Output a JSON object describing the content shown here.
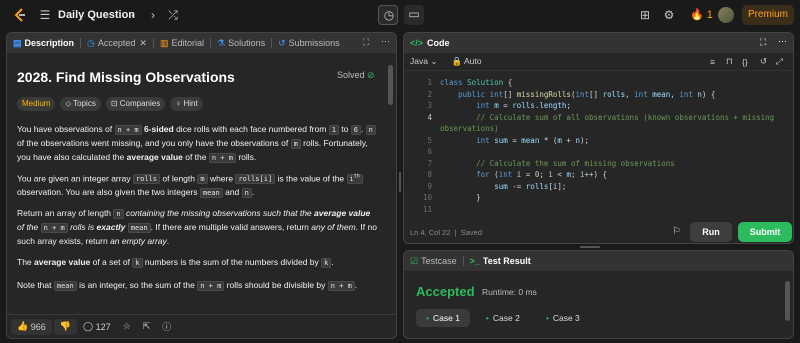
{
  "topbar": {
    "title": "Daily Question",
    "streak": "1",
    "premium": "Premium"
  },
  "left": {
    "tabs": [
      "Description",
      "Accepted",
      "Editorial",
      "Solutions",
      "Submissions"
    ],
    "title": "2028. Find Missing Observations",
    "solved": "Solved",
    "chips": [
      "Medium",
      "Topics",
      "Companies",
      "Hint"
    ],
    "p1": {
      "a": "You have observations of ",
      "c1": "n + m",
      "b": " 6-sided",
      "c": " dice rolls with each face numbered from ",
      "c2": "1",
      "d": " to ",
      "c3": "6",
      "e": ". ",
      "c4": "n",
      "f": " of the observations went missing, and you only have the observations of ",
      "c5": "m",
      "g": " rolls. Fortunately, you have also calculated the ",
      "h": "average value",
      "i": " of the ",
      "c6": "n + m",
      "j": " rolls."
    },
    "p2": {
      "a": "You are given an integer array ",
      "c1": "rolls",
      "b": " of length ",
      "c2": "m",
      "c": " where ",
      "c3": "rolls[i]",
      "d": " is the value of the ",
      "c4": "i",
      "sup": "th",
      "e": " observation. You are also given the two integers ",
      "c5": "mean",
      "f": " and ",
      "c6": "n",
      "g": "."
    },
    "p3": {
      "a": "Return an array of length ",
      "c1": "n",
      "b": " containing the missing observations such that the ",
      "bold": "average value",
      "c": " of the ",
      "c2": "n + m",
      "d": " rolls is ",
      "ex": "exactly",
      "c3": "mean",
      "e": ". If there are multiple valid answers, return ",
      "any": "any of them",
      "f": ". If no such array exists, return ",
      "empty": "an empty array",
      "g": "."
    },
    "p4": {
      "a": "The ",
      "bold": "average value",
      "b": " of a set of ",
      "c1": "k",
      "c": " numbers is the sum of the numbers divided by ",
      "c2": "k",
      "d": "."
    },
    "p5": {
      "a": "Note that ",
      "c1": "mean",
      "b": " is an integer, so the sum of the ",
      "c2": "n + m",
      "c": " rolls should be divisible by ",
      "c3": "n + m",
      "d": "."
    },
    "likes": "966",
    "comments": "127"
  },
  "code": {
    "header": "Code",
    "language": "Java",
    "mode": "Auto",
    "lines": [
      {
        "n": "1",
        "html": "<span class='kw'>class</span> <span class='ty'>Solution</span> {"
      },
      {
        "n": "2",
        "html": "    <span class='kw'>public</span> <span class='kw'>int</span>[] <span class='fn'>missingRolls</span>(<span class='kw'>int</span>[] <span class='vr'>rolls</span>, <span class='kw'>int</span> <span class='vr'>mean</span>, <span class='kw'>int</span> <span class='vr'>n</span>) {"
      },
      {
        "n": "3",
        "html": "        <span class='kw'>int</span> <span class='vr'>m</span> = <span class='vr'>rolls</span>.<span class='vr'>length</span>;"
      },
      {
        "n": "4",
        "html": "        <span class='cm'>// Calculate sum of all observations (known observations + missing</span>"
      },
      {
        "n": "",
        "html": "<span class='cm'>observations)</span>"
      },
      {
        "n": "5",
        "html": "        <span class='kw'>int</span> <span class='vr'>sum</span> = <span class='vr'>mean</span> * (<span class='vr'>m</span> + <span class='vr'>n</span>);"
      },
      {
        "n": "6",
        "html": ""
      },
      {
        "n": "7",
        "html": "        <span class='cm'>// Calculate the sum of missing observations</span>"
      },
      {
        "n": "8",
        "html": "        <span class='kw'>for</span> (<span class='kw'>int</span> <span class='vr'>i</span> = <span class='nm'>0</span>; <span class='vr'>i</span> &lt; <span class='vr'>m</span>; <span class='vr'>i</span>++) {"
      },
      {
        "n": "9",
        "html": "            <span class='vr'>sum</span> -= <span class='vr'>rolls</span>[<span class='vr'>i</span>];"
      },
      {
        "n": "10",
        "html": "        }"
      },
      {
        "n": "11",
        "html": ""
      }
    ],
    "status_pos": "Ln 4, Col 22",
    "status_saved": "Saved",
    "run": "Run",
    "submit": "Submit"
  },
  "test": {
    "tab1": "Testcase",
    "tab2": "Test Result",
    "result": "Accepted",
    "runtime": "Runtime: 0 ms",
    "cases": [
      "Case 1",
      "Case 2",
      "Case 3"
    ]
  },
  "colors": {
    "accent": "#ffa116",
    "accepted": "#2cbb5d",
    "medium": "#ffb800"
  }
}
